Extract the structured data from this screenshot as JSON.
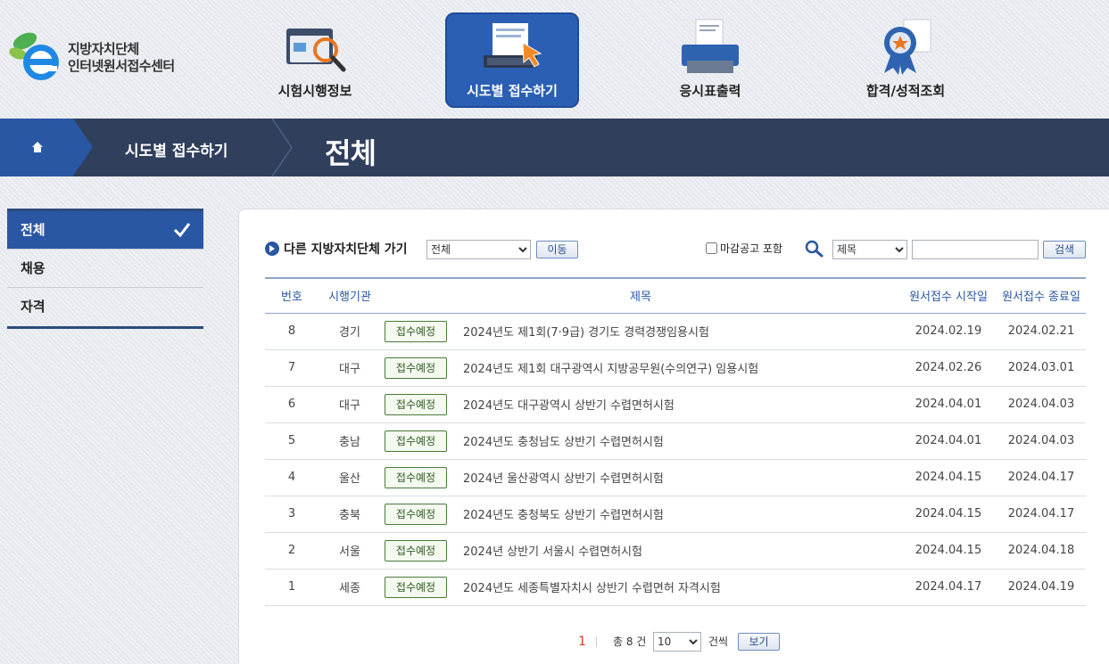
{
  "logo": {
    "line1": "지방자치단체",
    "line2": "인터넷원서접수센터"
  },
  "nav": [
    {
      "label": "시험시행정보",
      "icon": "folder-search-icon",
      "active": false
    },
    {
      "label": "시도별 접수하기",
      "icon": "laptop-click-icon",
      "active": true
    },
    {
      "label": "응시표출력",
      "icon": "printer-icon",
      "active": false
    },
    {
      "label": "합격/성적조회",
      "icon": "award-ribbon-icon",
      "active": false
    }
  ],
  "breadcrumb": {
    "level1": "시도별 접수하기",
    "current": "전체"
  },
  "sidebar": [
    {
      "label": "전체",
      "active": true
    },
    {
      "label": "채용",
      "active": false
    },
    {
      "label": "자격",
      "active": false
    }
  ],
  "toolbar": {
    "goto_label": "다른 지방자치단체 가기",
    "region_selected": "전체",
    "go_button": "이동",
    "include_closed_label": "마감공고 포함",
    "field_selected": "제목",
    "search_value": "",
    "search_button": "검색"
  },
  "table": {
    "headers": {
      "num": "번호",
      "org": "시행기관",
      "title": "제목",
      "start": "원서접수 시작일",
      "end": "원서접수 종료일"
    },
    "rows": [
      {
        "num": "8",
        "org": "경기",
        "status": "접수예정",
        "title": "2024년도 제1회(7·9급) 경기도 경력경쟁임용시험",
        "start": "2024.02.19",
        "end": "2024.02.21"
      },
      {
        "num": "7",
        "org": "대구",
        "status": "접수예정",
        "title": "2024년도 제1회 대구광역시 지방공무원(수의연구) 임용시험",
        "start": "2024.02.26",
        "end": "2024.03.01"
      },
      {
        "num": "6",
        "org": "대구",
        "status": "접수예정",
        "title": "2024년도 대구광역시 상반기 수렵면허시험",
        "start": "2024.04.01",
        "end": "2024.04.03"
      },
      {
        "num": "5",
        "org": "충남",
        "status": "접수예정",
        "title": "2024년도 충청남도 상반기 수렵면허시험",
        "start": "2024.04.01",
        "end": "2024.04.03"
      },
      {
        "num": "4",
        "org": "울산",
        "status": "접수예정",
        "title": "2024년 울산광역시 상반기 수렵면허시험",
        "start": "2024.04.15",
        "end": "2024.04.17"
      },
      {
        "num": "3",
        "org": "충북",
        "status": "접수예정",
        "title": "2024년도 충청북도 상반기 수렵면허시험",
        "start": "2024.04.15",
        "end": "2024.04.17"
      },
      {
        "num": "2",
        "org": "서울",
        "status": "접수예정",
        "title": "2024년 상반기 서울시 수렵면허시험",
        "start": "2024.04.15",
        "end": "2024.04.18"
      },
      {
        "num": "1",
        "org": "세종",
        "status": "접수예정",
        "title": "2024년도 세종특별자치시 상반기 수렵면허 자격시험",
        "start": "2024.04.17",
        "end": "2024.04.19"
      }
    ]
  },
  "pager": {
    "current_page": "1",
    "total_label": "총 8 건",
    "page_size": "10",
    "unit_label": "건씩",
    "view_button": "보기"
  }
}
